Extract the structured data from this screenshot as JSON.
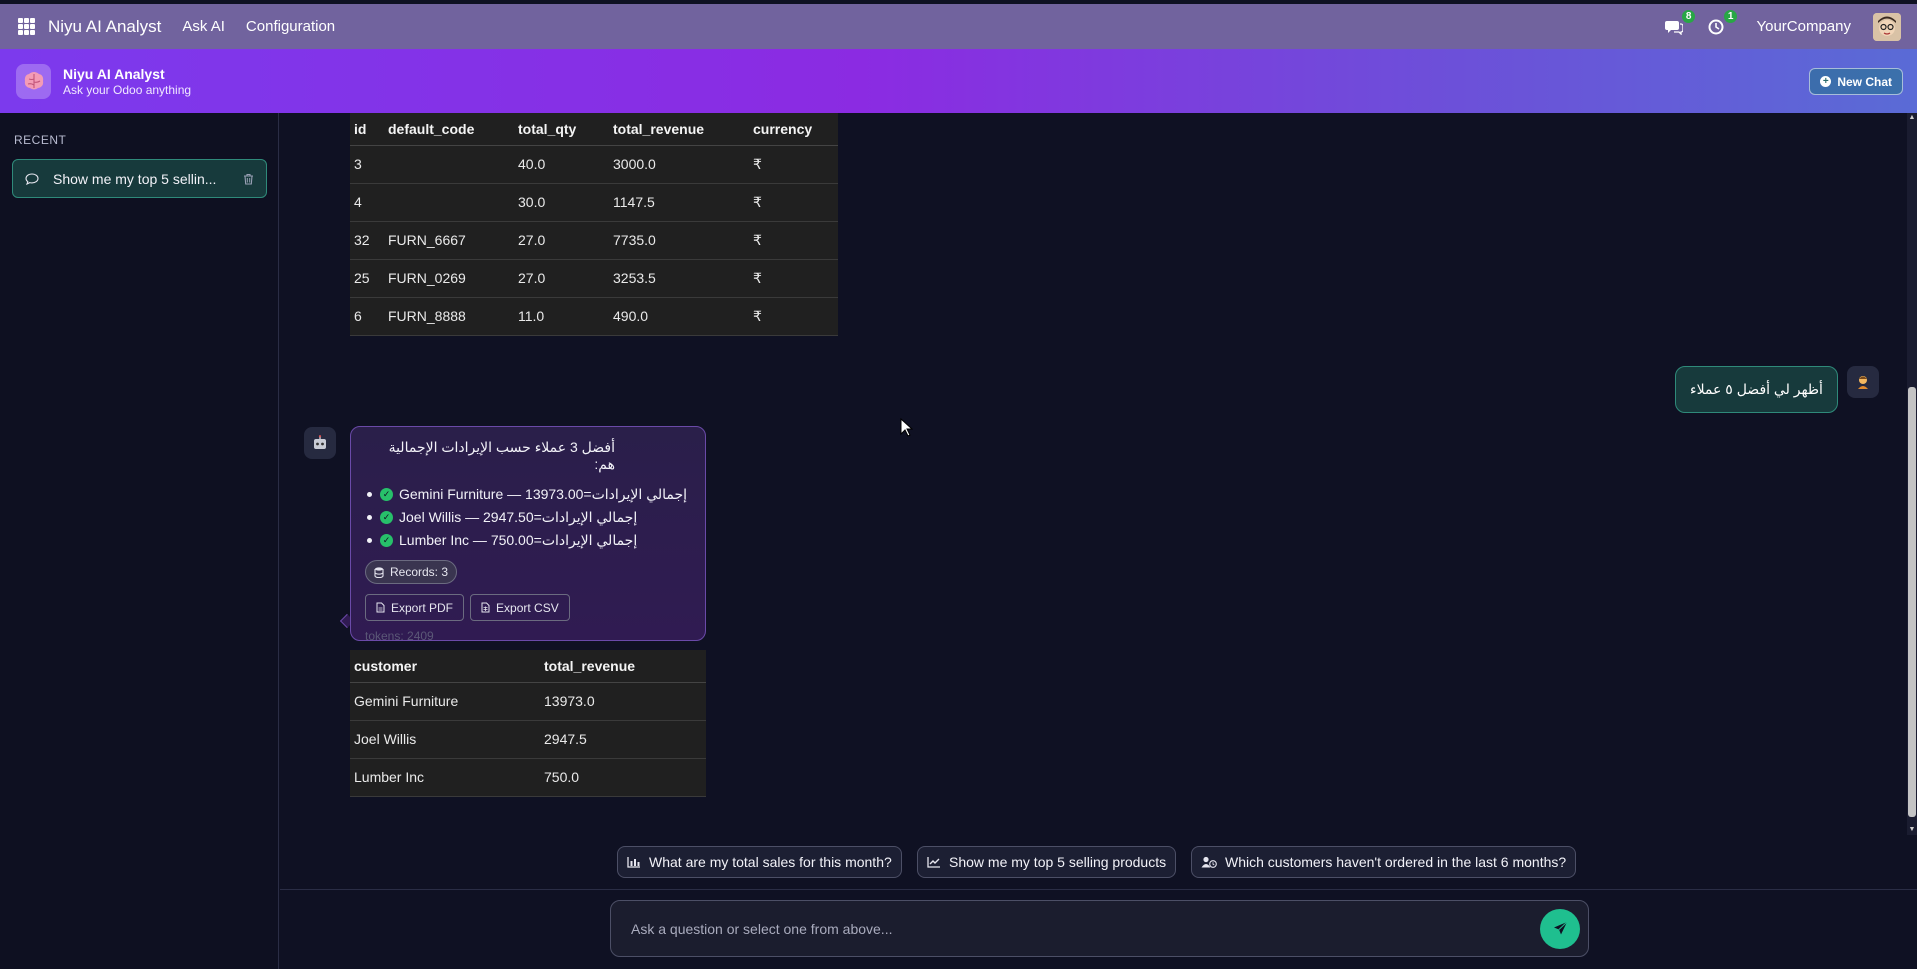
{
  "navbar": {
    "app_title": "Niyu AI Analyst",
    "menu": [
      "Ask AI",
      "Configuration"
    ],
    "messages_badge": "8",
    "activity_badge": "1",
    "company": "YourCompany"
  },
  "header": {
    "title": "Niyu AI Analyst",
    "subtitle": "Ask your Odoo anything",
    "new_chat_label": "New Chat",
    "gradient_colors": [
      "#7c3aed",
      "#8b2be2",
      "#5a6bd6"
    ]
  },
  "sidebar": {
    "section_label": "RECENT",
    "chats": [
      {
        "label": "Show me my top 5 sellin..."
      }
    ]
  },
  "products_table": {
    "columns": [
      "id",
      "default_code",
      "total_qty",
      "total_revenue",
      "currency"
    ],
    "rows": [
      [
        "3",
        "",
        "40.0",
        "3000.0",
        "₹"
      ],
      [
        "4",
        "",
        "30.0",
        "1147.5",
        "₹"
      ],
      [
        "32",
        "FURN_6667",
        "27.0",
        "7735.0",
        "₹"
      ],
      [
        "25",
        "FURN_0269",
        "27.0",
        "3253.5",
        "₹"
      ],
      [
        "6",
        "FURN_8888",
        "11.0",
        "490.0",
        "₹"
      ]
    ]
  },
  "user_message": {
    "text": "أظهر لي أفضل ٥ عملاء"
  },
  "bot_message": {
    "intro": "أفضل 3 عملاء حسب الإيرادات الإجمالية هم:",
    "items": [
      "Gemini Furniture — 13973.00=إجمالي الإيرادات",
      "Joel Willis — 2947.50=إجمالي الإيرادات",
      "Lumber Inc — 750.00=إجمالي الإيرادات"
    ],
    "records_label": "Records: 3",
    "export_pdf_label": "Export PDF",
    "export_csv_label": "Export CSV",
    "tokens_label": "tokens: 2409",
    "accent_color": "#6a4aa8"
  },
  "customers_table": {
    "columns": [
      "customer",
      "total_revenue"
    ],
    "rows": [
      [
        "Gemini Furniture",
        "13973.0"
      ],
      [
        "Joel Willis",
        "2947.5"
      ],
      [
        "Lumber Inc",
        "750.0"
      ]
    ]
  },
  "suggestions": [
    {
      "icon": "bar-chart-icon",
      "label": "What are my total sales for this month?"
    },
    {
      "icon": "line-chart-icon",
      "label": "Show me my top 5 selling products"
    },
    {
      "icon": "user-clock-icon",
      "label": "Which customers haven't ordered in the last 6 months?"
    }
  ],
  "composer": {
    "placeholder": "Ask a question or select one from above...",
    "send_color": "#1fbf8f"
  }
}
